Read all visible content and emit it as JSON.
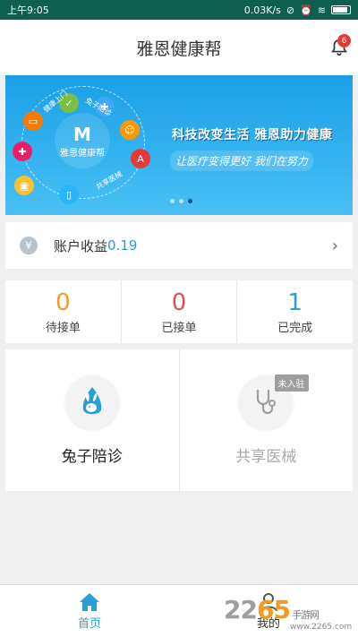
{
  "status": {
    "time": "上午9:05",
    "network": "0.03K/s",
    "battery_pct": 100
  },
  "header": {
    "title": "雅恩健康帮",
    "notification_count": "6"
  },
  "banner": {
    "slogan_main": "科技改变生活 雅恩助力健康",
    "slogan_sub": "让医疗变得更好 我们在努力",
    "logo_text": "雅恩健康帮",
    "ring_texts": [
      "健康上门",
      "兔子陪诊",
      "共享医械"
    ]
  },
  "earnings": {
    "label": "账户收益",
    "value": "0.19"
  },
  "orders": [
    {
      "count": "0",
      "label": "待接单",
      "color": "#f29b24"
    },
    {
      "count": "0",
      "label": "已接单",
      "color": "#d9534f"
    },
    {
      "count": "1",
      "label": "已完成",
      "color": "#2a9fd6"
    }
  ],
  "services": [
    {
      "name": "兔子陪诊",
      "active": true
    },
    {
      "name": "共享医械",
      "active": false,
      "tag": "未入驻"
    }
  ],
  "tabs": [
    {
      "label": "首页",
      "active": true,
      "color": "#2a9fd6"
    },
    {
      "label": "我的",
      "active": false,
      "color": "#333333"
    }
  ],
  "watermark": {
    "brand_a": "22",
    "brand_b": "65",
    "suffix": "手游网",
    "url": "www.2265.com"
  }
}
